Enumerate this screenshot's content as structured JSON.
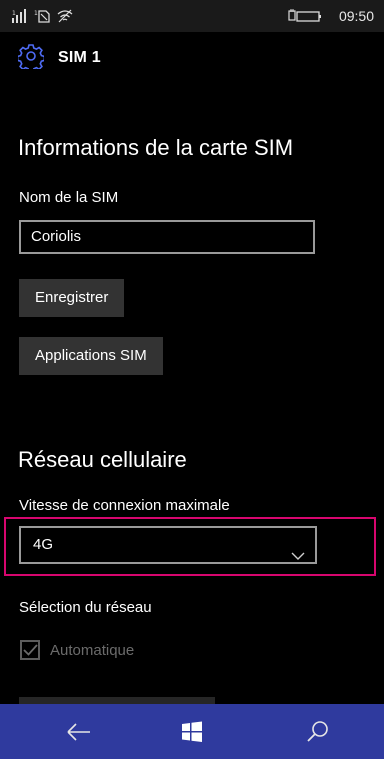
{
  "status_bar": {
    "time": "09:50",
    "icons": [
      "signal-icon",
      "sim-signal-icon",
      "wifi-off-icon",
      "battery-icon"
    ]
  },
  "header": {
    "title": "SIM 1",
    "icon": "gear-icon"
  },
  "sim_info": {
    "section_title": "Informations de la carte SIM",
    "name_label": "Nom de la SIM",
    "name_value": "Coriolis",
    "save_button": "Enregistrer",
    "sim_apps_button": "Applications SIM"
  },
  "cellular": {
    "section_title": "Réseau cellulaire",
    "max_speed_label": "Vitesse de connexion maximale",
    "max_speed_value": "4G",
    "network_selection_label": "Sélection du réseau",
    "automatic_label": "Automatique",
    "automatic_checked": true
  },
  "nav_bar": {
    "icons": [
      "back-arrow-icon",
      "windows-start-icon",
      "search-icon"
    ],
    "color": "#2f3a9e"
  },
  "colors": {
    "highlight": "#d8066f",
    "background": "#000000",
    "button": "#333333"
  }
}
